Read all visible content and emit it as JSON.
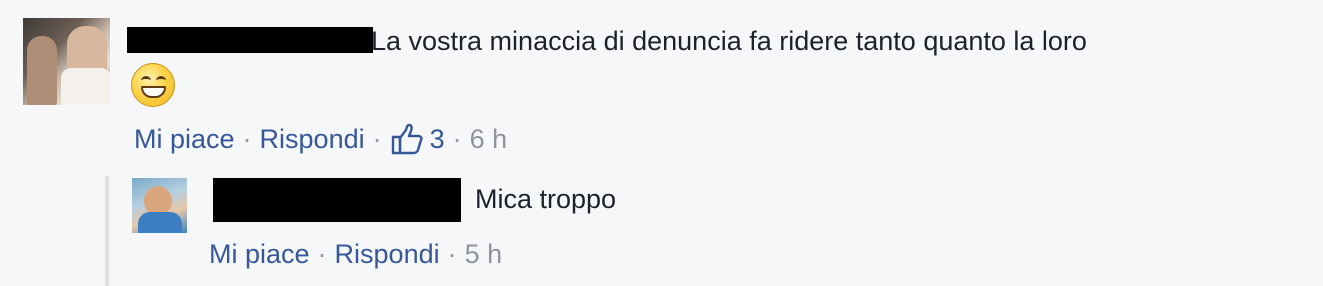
{
  "comment": {
    "text": "La vostra minaccia di denuncia fa ridere tanto quanto la loro",
    "emoji": "grinning-face-emoji",
    "actions": {
      "like_label": "Mi piace",
      "reply_label": "Rispondi",
      "like_count": "3",
      "time": "6 h"
    }
  },
  "reply": {
    "text": "Mica troppo",
    "actions": {
      "like_label": "Mi piace",
      "reply_label": "Rispondi",
      "time": "5 h"
    }
  },
  "colors": {
    "link": "#365899",
    "muted": "#90949c",
    "background": "#f6f7f9"
  },
  "icons": {
    "like": "thumbs-up-icon"
  }
}
